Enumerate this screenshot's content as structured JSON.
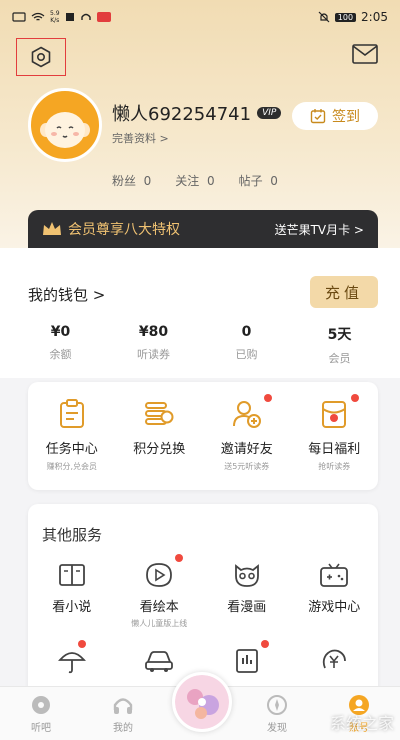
{
  "status_bar": {
    "net_speed_top": "5.9",
    "net_speed_bottom": "K/s",
    "battery": "100",
    "time": "2:05"
  },
  "icons": {
    "settings": "gear-hexagon-icon",
    "mail": "mail-icon",
    "checkin": "calendar-check-icon",
    "crown": "crown-icon"
  },
  "profile": {
    "username": "懒人692254741",
    "vip_badge": "VIP",
    "edit_profile": "完善资料 >",
    "checkin_label": "签到",
    "stats": [
      {
        "label": "粉丝",
        "value": "0"
      },
      {
        "label": "关注",
        "value": "0"
      },
      {
        "label": "帖子",
        "value": "0"
      }
    ]
  },
  "vip_banner": {
    "title": "会员尊享八大特权",
    "link": "送芒果TV月卡 >"
  },
  "wallet": {
    "title": "我的钱包 >",
    "recharge_label": "充值",
    "items": [
      {
        "value": "¥0",
        "label": "余额"
      },
      {
        "value": "¥80",
        "label": "听读券"
      },
      {
        "value": "0",
        "label": "已购"
      },
      {
        "value": "5天",
        "label": "会员"
      }
    ]
  },
  "tasks": [
    {
      "title": "任务中心",
      "sub": "赚积分,兑会员",
      "dot": false
    },
    {
      "title": "积分兑换",
      "sub": "",
      "dot": false
    },
    {
      "title": "邀请好友",
      "sub": "送5元听读券",
      "dot": true
    },
    {
      "title": "每日福利",
      "sub": "抢听读券",
      "dot": true
    }
  ],
  "services": {
    "title": "其他服务",
    "items": [
      {
        "title": "看小说",
        "sub": "",
        "dot": false
      },
      {
        "title": "看绘本",
        "sub": "懒人儿童版上线",
        "dot": true
      },
      {
        "title": "看漫画",
        "sub": "",
        "dot": false
      },
      {
        "title": "游戏中心",
        "sub": "",
        "dot": false
      }
    ]
  },
  "bottom_nav": [
    {
      "label": "听吧",
      "active": false
    },
    {
      "label": "我的",
      "active": false
    },
    {
      "label": "发现",
      "active": false
    },
    {
      "label": "账号",
      "active": true
    }
  ],
  "watermark": "系统之家",
  "colors": {
    "accent": "#f5a623",
    "vip_banner_bg": "#2e2e30",
    "vip_gold": "#f0c272",
    "red_dot": "#f04a3e"
  }
}
